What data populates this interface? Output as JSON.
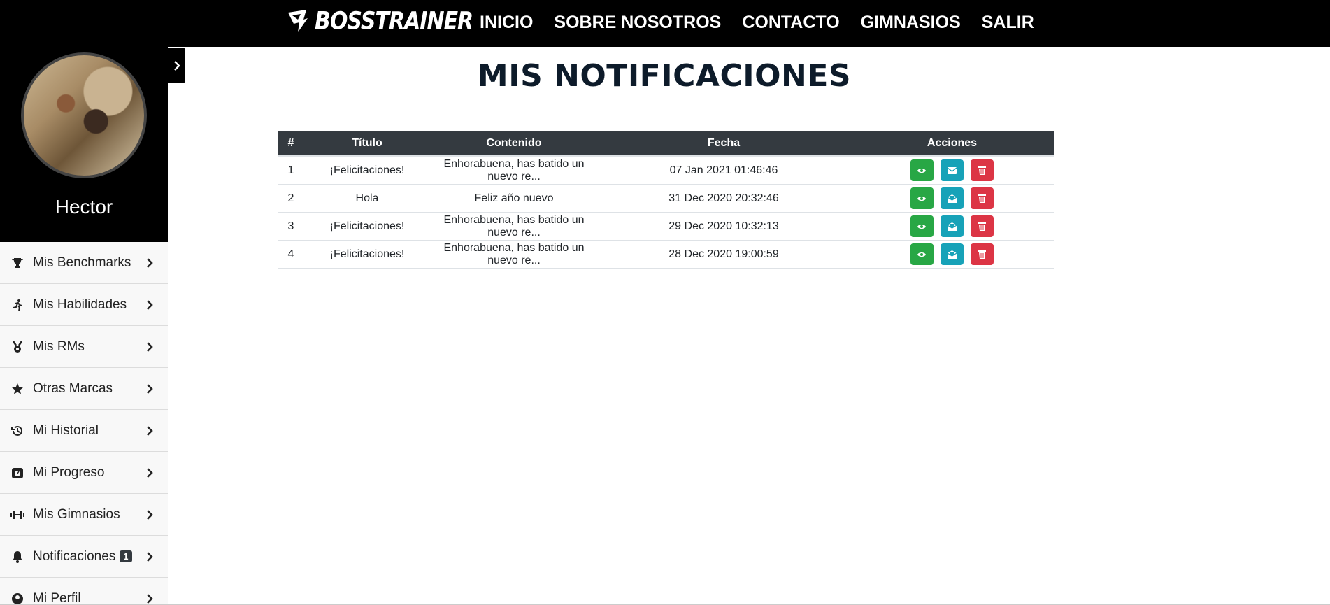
{
  "brand": {
    "name": "BOSSTRAINER"
  },
  "nav": {
    "links": [
      "INICIO",
      "SOBRE NOSOTROS",
      "CONTACTO",
      "GIMNASIOS",
      "SALIR"
    ]
  },
  "sidebar": {
    "user_name": "Hector",
    "items": [
      {
        "label": "Mis Benchmarks",
        "icon": "trophy-icon"
      },
      {
        "label": "Mis Habilidades",
        "icon": "running-icon"
      },
      {
        "label": "Mis RMs",
        "icon": "medal-icon"
      },
      {
        "label": "Otras Marcas",
        "icon": "star-icon"
      },
      {
        "label": "Mi Historial",
        "icon": "history-icon"
      },
      {
        "label": "Mi Progreso",
        "icon": "progress-icon"
      },
      {
        "label": "Mis Gimnasios",
        "icon": "dumbbell-icon"
      },
      {
        "label": "Notificaciones",
        "icon": "bell-icon",
        "badge": "1"
      },
      {
        "label": "Mi Perfil",
        "icon": "user-icon"
      }
    ]
  },
  "main": {
    "title": "MIS NOTIFICACIONES",
    "table": {
      "headers": [
        "#",
        "Título",
        "Contenido",
        "Fecha",
        "Acciones"
      ],
      "rows": [
        {
          "num": "1",
          "title": "¡Felicitaciones!",
          "content": "Enhorabuena, has batido un nuevo re...",
          "date": "07 Jan 2021 01:46:46",
          "read": false
        },
        {
          "num": "2",
          "title": "Hola",
          "content": "Feliz año nuevo",
          "date": "31 Dec 2020 20:32:46",
          "read": true
        },
        {
          "num": "3",
          "title": "¡Felicitaciones!",
          "content": "Enhorabuena, has batido un nuevo re...",
          "date": "29 Dec 2020 10:32:13",
          "read": true
        },
        {
          "num": "4",
          "title": "¡Felicitaciones!",
          "content": "Enhorabuena, has batido un nuevo re...",
          "date": "28 Dec 2020 19:00:59",
          "read": true
        }
      ]
    }
  },
  "colors": {
    "view_button": "#28a745",
    "mail_button": "#17a2b8",
    "delete_button": "#dc3545",
    "table_header": "#343a40"
  }
}
